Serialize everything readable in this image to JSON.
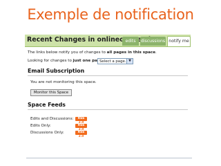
{
  "slide_title": "Exemple de notification",
  "header": {
    "title": "Recent Changes in onlineconnections",
    "tabs": [
      "edits",
      "discussions",
      "notify me"
    ]
  },
  "intro": {
    "prefix": "The links below notify you of changes to ",
    "bold": "all pages in this space",
    "suffix": "."
  },
  "one_page": {
    "prefix": "Looking for changes to ",
    "bold": "just one page",
    "suffix": "?",
    "select_value": "Select a page..."
  },
  "email": {
    "heading": "Email Subscription",
    "status": "You are not monitoring this space.",
    "button": "Monitor this Space"
  },
  "feeds": {
    "heading": "Space Feeds",
    "items": [
      {
        "label": "Edits and Discussions:",
        "badge_left": "RSS",
        "badge_right": "2.0"
      },
      {
        "label": "Edits Only:",
        "badge_left": "RSS",
        "badge_right": "2.0"
      },
      {
        "label": "Discussions Only:",
        "badge_left": "RSS",
        "badge_right": "2.0"
      }
    ]
  },
  "colors": {
    "title": "#e8621c",
    "header_bg": "#cde2a8",
    "tab_bg": "#8cb36b",
    "rss": "#f26c1d"
  }
}
